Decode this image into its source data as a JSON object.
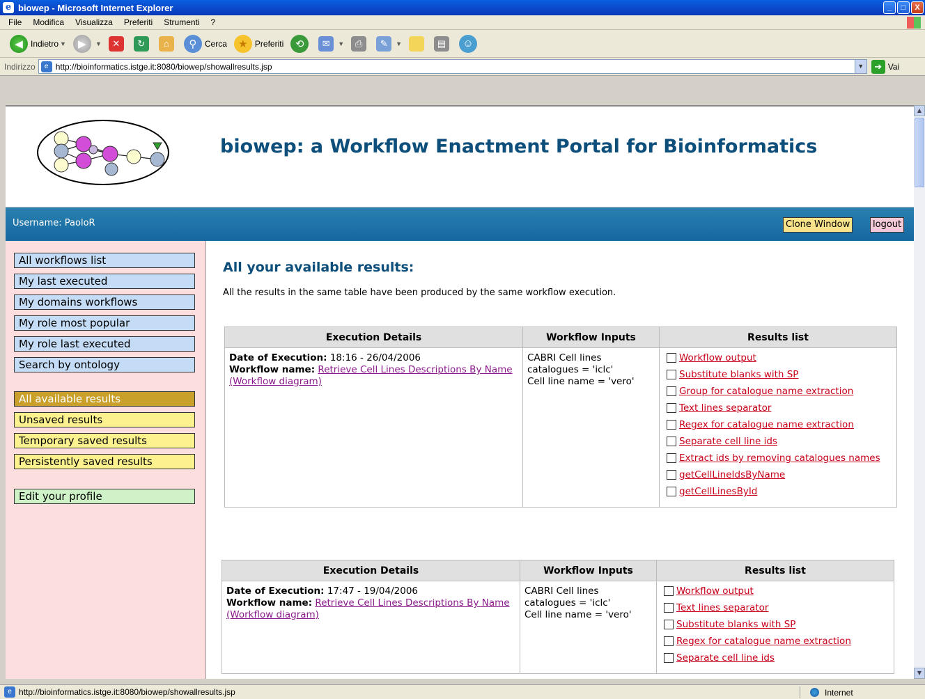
{
  "window": {
    "title": "biowep - Microsoft Internet Explorer",
    "controls": {
      "minimize": "_",
      "maximize": "□",
      "close": "X"
    }
  },
  "menu": [
    "File",
    "Modifica",
    "Visualizza",
    "Preferiti",
    "Strumenti",
    "?"
  ],
  "toolbar": {
    "back_label": "Indietro",
    "search_label": "Cerca",
    "favorites_label": "Preferiti"
  },
  "address": {
    "label": "Indirizzo",
    "url": "http://bioinformatics.istge.it:8080/biowep/showallresults.jsp",
    "go_label": "Vai"
  },
  "status": {
    "url": "http://bioinformatics.istge.it:8080/biowep/showallresults.jsp",
    "zone": "Internet"
  },
  "page": {
    "heading": "biowep: a Workflow Enactment Portal for Bioinformatics",
    "username_label": "Username: PaoloR",
    "clone_label": "Clone Window",
    "logout_label": "logout"
  },
  "sidebar": {
    "items": [
      {
        "label": "All workflows list",
        "style": "blue"
      },
      {
        "label": "My last executed",
        "style": "blue"
      },
      {
        "label": "My domains workflows",
        "style": "blue"
      },
      {
        "label": "My role most popular",
        "style": "blue"
      },
      {
        "label": "My role last executed",
        "style": "blue"
      },
      {
        "label": "Search by ontology",
        "style": "blue"
      },
      {
        "label": "All available results",
        "style": "active"
      },
      {
        "label": "Unsaved results",
        "style": "yellow"
      },
      {
        "label": "Temporary saved results",
        "style": "yellow"
      },
      {
        "label": "Persistently saved results",
        "style": "yellow"
      },
      {
        "label": "Edit your profile",
        "style": "green"
      }
    ]
  },
  "content": {
    "title": "All your available results:",
    "note": "All the results in the same table have been produced by the same workflow execution.",
    "headers": {
      "details": "Execution Details",
      "inputs": "Workflow Inputs",
      "results": "Results list"
    },
    "labels": {
      "date": "Date of Execution:",
      "workflow": "Workflow name:"
    },
    "tables": [
      {
        "date": "18:16 - 26/04/2006",
        "workflow_name": "Retrieve Cell Lines Descriptions By Name",
        "diagram_link": "(Workflow diagram)",
        "inputs": [
          "CABRI Cell lines catalogues = 'iclc'",
          "Cell line name = 'vero'"
        ],
        "results": [
          "Workflow output",
          "Substitute blanks with SP",
          "Group for catalogue name extraction",
          "Text lines separator",
          "Regex for catalogue name extraction",
          "Separate cell line ids",
          "Extract ids by removing catalogues names",
          "getCellLineIdsByName",
          "getCellLinesById"
        ]
      },
      {
        "date": "17:47 - 19/04/2006",
        "workflow_name": "Retrieve Cell Lines Descriptions By Name",
        "diagram_link": "(Workflow diagram)",
        "inputs": [
          "CABRI Cell lines catalogues = 'iclc'",
          "Cell line name = 'vero'"
        ],
        "results": [
          "Workflow output",
          "Text lines separator",
          "Substitute blanks with SP",
          "Regex for catalogue name extraction",
          "Separate cell line ids"
        ]
      }
    ]
  }
}
